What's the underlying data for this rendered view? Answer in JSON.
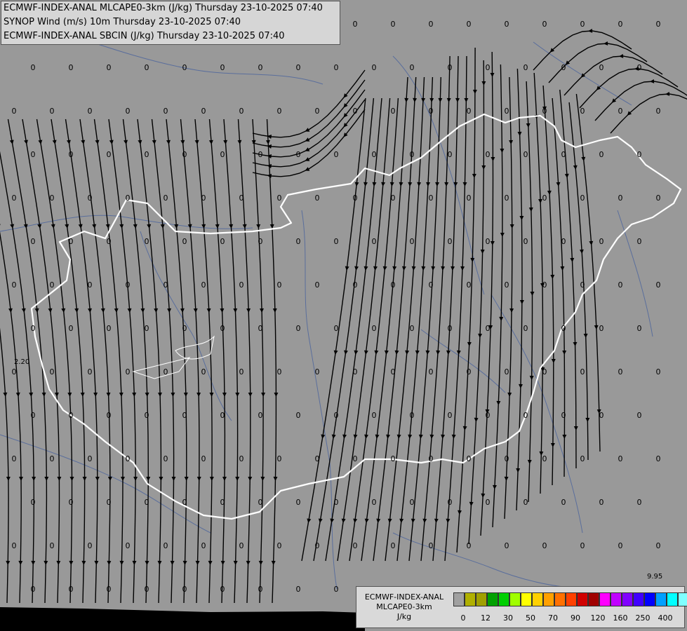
{
  "header": {
    "line1": "ECMWF-INDEX-ANAL MLCAPE0-3km (J/kg) Thursday 23-10-2025 07:40",
    "line2": "SYNOP Wind (m/s) 10m Thursday 23-10-2025 07:40",
    "line3": "ECMWF-INDEX-ANAL SBCIN (J/kg) Thursday 23-10-2025 07:40"
  },
  "legend": {
    "title_line1": "ECMWF-INDEX-ANAL",
    "title_line2": "MLCAPE0-3km",
    "title_line3": "J/kg",
    "colors": [
      "#a0a0a0",
      "#b0b000",
      "#a0a000",
      "#00a000",
      "#00d000",
      "#a0ff00",
      "#ffff00",
      "#ffd000",
      "#ffa000",
      "#ff7000",
      "#ff4000",
      "#d00000",
      "#a00000",
      "#ff00ff",
      "#c000ff",
      "#8000ff",
      "#4000ff",
      "#0000ff",
      "#00a0ff",
      "#00ffff",
      "#80ffff",
      "#ffffff"
    ],
    "ticks": [
      "0",
      "12",
      "30",
      "50",
      "70",
      "90",
      "120",
      "160",
      "250",
      "400"
    ]
  },
  "corner_value": "9.95",
  "map_label": "2.20",
  "grid_value": "0",
  "colors": {
    "background": "#999999",
    "border": "#ffffff",
    "rivers": "#5a6e9c",
    "streamlines": "#000000",
    "water": "#000000"
  }
}
